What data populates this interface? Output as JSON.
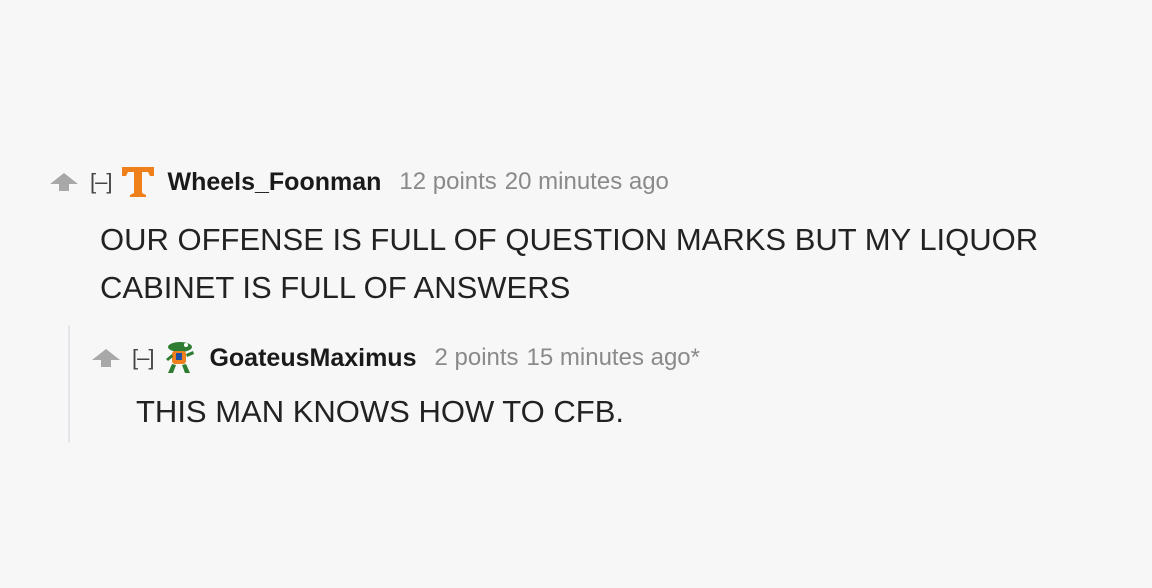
{
  "comments": [
    {
      "collapse_label": "[–]",
      "flair_icon": "tennessee-t-icon",
      "flair_color": "#ef7f1a",
      "author": "Wheels_Foonman",
      "score": "12 points",
      "time": "20 minutes ago",
      "body": "OUR OFFENSE IS FULL OF QUESTION MARKS BUT MY LIQUOR CABINET IS FULL OF ANSWERS"
    },
    {
      "collapse_label": "[–]",
      "flair_icon": "gator-mascot-icon",
      "author": "GoateusMaximus",
      "score": "2 points",
      "time": "15 minutes ago*",
      "body": "THIS MAN KNOWS HOW TO CFB."
    }
  ],
  "upvote_icon": "upvote-arrow-icon",
  "upvote_color": "#a8a8a8"
}
